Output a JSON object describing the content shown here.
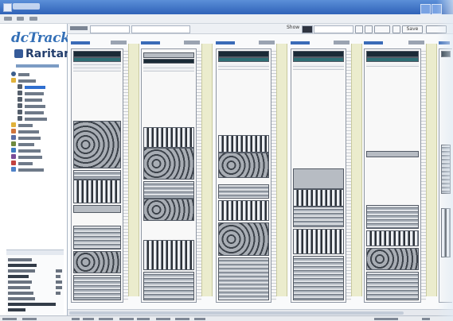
{
  "app": {
    "title": "",
    "menus": [
      "",
      "",
      ""
    ]
  },
  "sidebar": {
    "logo_text": "dcTrack",
    "brand_name": "Raritan",
    "version": "",
    "tree_items": [
      {
        "label": "",
        "icon": "globe-icon",
        "selected": false
      },
      {
        "label": "",
        "icon": "folder-icon",
        "selected": false
      },
      {
        "label": "",
        "icon": "server-icon",
        "selected": true
      },
      {
        "label": "",
        "icon": "server-icon",
        "selected": false
      },
      {
        "label": "",
        "icon": "server-icon",
        "selected": false
      },
      {
        "label": "",
        "icon": "server-icon",
        "selected": false
      },
      {
        "label": "",
        "icon": "server-icon",
        "selected": false
      },
      {
        "label": "",
        "icon": "server-icon",
        "selected": false
      },
      {
        "label": "",
        "icon": "folder-icon",
        "selected": false
      },
      {
        "label": "",
        "icon": "folder-icon",
        "selected": false
      },
      {
        "label": "",
        "icon": "folder-icon",
        "selected": false
      },
      {
        "label": "",
        "icon": "folder-icon",
        "selected": false
      },
      {
        "label": "",
        "icon": "folder-icon",
        "selected": false
      },
      {
        "label": "",
        "icon": "folder-icon",
        "selected": false
      },
      {
        "label": "",
        "icon": "folder-icon",
        "selected": false
      },
      {
        "label": "",
        "icon": "folder-icon",
        "selected": false
      }
    ],
    "details": [
      {
        "label": "",
        "value": ""
      },
      {
        "label": "",
        "value": ""
      },
      {
        "label": "",
        "value": ""
      },
      {
        "label": "",
        "value": ""
      },
      {
        "label": "",
        "value": ""
      },
      {
        "label": "",
        "value": ""
      },
      {
        "label": "",
        "value": ""
      },
      {
        "label": "",
        "value": ""
      },
      {
        "label": "",
        "value": ""
      },
      {
        "label": "",
        "value": ""
      }
    ]
  },
  "toolbar": {
    "search_by_label": "",
    "search_value": "",
    "show_label": "Show",
    "view_select": "",
    "save_label": "Save",
    "extra_button": ""
  },
  "cabinets": [
    {
      "label": ""
    },
    {
      "label": ""
    },
    {
      "label": ""
    },
    {
      "label": ""
    },
    {
      "label": ""
    },
    {
      "label": ""
    }
  ],
  "status_bar": {
    "cells": [
      "",
      "",
      "",
      "",
      "",
      "",
      "",
      "",
      "",
      "",
      "",
      ""
    ]
  },
  "colors": {
    "accent": "#3470b7",
    "title_bar": "#2f62b8",
    "brand": "#233e6d",
    "separator": "#ebeccd"
  }
}
